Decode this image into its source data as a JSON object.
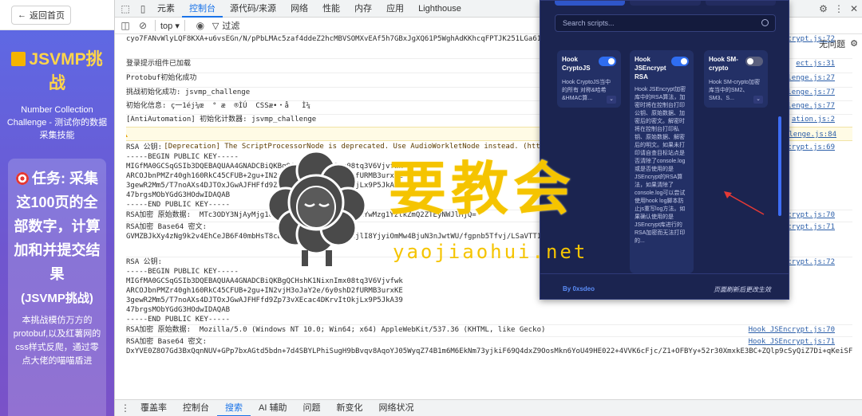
{
  "left_panel": {
    "back_button": "返回首页",
    "title": "JSVMP挑战",
    "subtitle": "Number Collection Challenge - 测试你的数据采集技能",
    "task_title": "任务: 采集这100页的全部数字，计算加和并提交结果",
    "task_sub": "(JSVMP挑战)",
    "task_desc": "本挑战模仿万方的protobuf,以及红薯网的css样式反爬，通过零点大佬的喵喵盾进"
  },
  "devtools": {
    "tabs": [
      "元素",
      "控制台",
      "源代码/来源",
      "网络",
      "性能",
      "内存",
      "应用",
      "Lighthouse"
    ],
    "active_tab": "控制台",
    "toolbar": {
      "context": "top",
      "filter_placeholder": "过滤",
      "no_issues": "无问题"
    },
    "bottom_tabs": [
      "覆盖率",
      "控制台",
      "搜索",
      "AI 辅助",
      "问题",
      "新变化",
      "网络状况"
    ],
    "active_bottom_tab": "搜索",
    "prompt_symbol": "›"
  },
  "console_lines": [
    {
      "text": "cyo7FANvWlyLQF8KXA+u6vsEGn/N/pPbLMAc5zaf4ddeZ2hcMBVSOMXvEAf5h7GBxJgXQ61P5WghAdKKhcqFPTJK251LGa61C2o69UD/0",
      "src": "crypt.js:72"
    },
    {
      "text": "登录提示组件已加载",
      "src": "ect.js:31"
    },
    {
      "text": "Protobuf初始化成功",
      "src": "lenge.js:27"
    },
    {
      "text": "挑战初始化成功: jsvmp_challenge",
      "src": "lenge.js:77"
    },
    {
      "text": "初始化信息: ç一1éj¼œ  ° æ  ®ÌÚ  CSSæ•・å   Ì¼",
      "src": "lenge.js:77"
    },
    {
      "text": "[AntiAutomation] 初始化计数器: jsvmp_challenge",
      "src": "ation.js:2"
    },
    {
      "text": "RSA 公钥:\n-----BEGIN PUBLIC KEY-----\nMIGfMA0GCSqGSIb3DQEBAQUAA4GNADCBiQKBgQCHshK1NixnImx08tq3V6Vjvfwk\nARCOJbnPMZr40gh160RkC45CFUB+2gu+IN2vjH3oJaY2e/6y0shD2fURMB3urxKE\n3gewR2Mm5/T7noAXs4DJTOxJGwAJFHFfd9Zp73vXEcac4DKrvItOkjLx9P5JkA39\n47brgsMObYGdG3HOdwIDAQAB\n-----END PUBLIC KEY-----",
      "src": "crypt.js:69"
    },
    {
      "text": "RSA加密 原始数据:  MTc3ODY3NjAyMjg1OHxjOGJmODE4MmYxZDk2NmYwMzg1YzlkZmQ2ZTEyNWJlMjQ=",
      "src": "crypt.js:70"
    },
    {
      "text": "RSA加密 Base64 密文:\nGVMZBJkXy4zNg9k2v4EhCeJB6F40mbHsT8cDhbDGU8pMX0bmXBDWIjlI8YjyiOmMw4BjuN3nJwtWU/fgpnb5Tfvj/LSaVTT115+w6HVBTHdHoE",
      "src": "crypt.js:71"
    },
    {
      "text": "RSA 公钥:\n-----BEGIN PUBLIC KEY-----\nMIGfMA0GCSqGSIb3DQEBAQUAA4GNADCBiQKBgQCHshK1NixnImx08tq3V6Vjvfwk\nARCOJbnPMZr40gh160RkC45CFUB+2gu+IN2vjH3oJaY2e/6y0shD2fURMB3urxKE\n3gewR2Mm5/T7noAXs4DJTOxJGwAJFHFfd9Zp73vXEcac4DKrvItOkjLx9P5JkA39\n47brgsMObYGdG3HOdwIDAQAB\n-----END PUBLIC KEY-----",
      "src": "crypt.js:72"
    },
    {
      "text": "RSA加密 原始数据:  Mozilla/5.0 (Windows NT 10.0; Win64; x64) AppleWebKit/537.36 (KHTML, like Gecko)",
      "src": "Hook_JSEncrypt.js:70"
    },
    {
      "text": "RSA加密 Base64 密文:\nDxYVE0Z8O7Gd3BxQqnNUV+GPp7bxAGtd5bdn+7d4SBYLPhiSugH9bBvqv8AqoYJ05WyqZ74B1m6M6EkNm73yjkiF69Q4dxZ9OosMkn6YoU49HE022+4VVK6cFjc/Z1+OFBYy+52r30XmxkE3BC+ZQlp9cSyQiZ7Di+qKeiSFA3o=",
      "src": "Hook_JSEncrypt.js:71"
    }
  ],
  "warning": {
    "text": "[Deprecation] The ScriptProcessorNode is deprecated. Use AudioWorkletNode instead. (https://bit.ly/audi",
    "src": "lenge.js:84"
  },
  "popup": {
    "search_placeholder": "Search scripts...",
    "cards": [
      {
        "title": "Hook CryptoJS",
        "desc": "Hook CryptoJS当中的所有 对称&哈希&HMAC算...",
        "enabled": true
      },
      {
        "title": "Hook JSEncrypt RSA",
        "desc": "Hook JSEncrypt加密库中的RSA算法，加密时将在控制台打印公钥、原始数据、加密后的密文。解密时将在控制台打印私钥、原始数据、解密后的明文。如果未打印请自查目标站点是否清除了console.log或是否使用的是JSEncrypt的RSA算法，如果清除了console.log可以尝试使用hook log脚本防止js重写log方法。如果确认使用的是JSEncrypt库进行的RSA加密而无法打印的...",
        "enabled": true
      },
      {
        "title": "Hook SM-crypto",
        "desc": "Hook SM-crypto加密库当中的SM2、SM3、S...",
        "enabled": false
      }
    ],
    "footer_by": "By 0xsdeo",
    "footer_note": "页面刷新后更改生效"
  },
  "watermark": {
    "text": "要教会",
    "url": "yaojiaohui.net"
  },
  "colors": {
    "accent": "#1a73e8",
    "popup_bg": "#1b2450",
    "toggle_on": "#2f6df0",
    "watermark": "#f5c400",
    "left_gradient_top": "#5c6be6"
  }
}
